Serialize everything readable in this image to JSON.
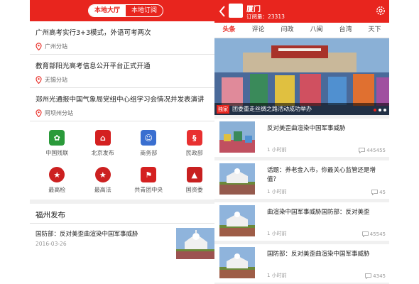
{
  "left": {
    "tabs": [
      "本地大厅",
      "本地订阅"
    ],
    "news": [
      {
        "title": "广州高考实行3+3模式，外语可考两次",
        "source": "广州分站"
      },
      {
        "title": "教育部阳光高考信息公开平台正式开通",
        "source": "无锡分站"
      },
      {
        "title": "郑州光通报中国气象局党组中心组学习会情况并发表演讲",
        "source": "阿坝州分站"
      }
    ],
    "grid": [
      {
        "label": "中国残联",
        "icon": "disabled-federation-icon",
        "color": "#2a9a3a"
      },
      {
        "label": "北京发布",
        "icon": "beijing-tiananmen-icon",
        "color": "#d42020"
      },
      {
        "label": "商务部",
        "icon": "commerce-ministry-icon",
        "color": "#3a6fd0"
      },
      {
        "label": "民政部",
        "icon": "civil-affairs-icon",
        "color": "#e83030"
      },
      {
        "label": "最高检",
        "icon": "procuratorate-emblem-icon",
        "color": "#cc2020"
      },
      {
        "label": "最高法",
        "icon": "court-emblem-icon",
        "color": "#cc2020"
      },
      {
        "label": "共青团中央",
        "icon": "youth-league-flag-icon",
        "color": "#d42020"
      },
      {
        "label": "国资委",
        "icon": "sasac-logo-icon",
        "color": "#c82020"
      }
    ],
    "section_title": "福州发布",
    "article": {
      "title": "国防部：反对美歪曲渲染中国军事威胁",
      "date": "2016-03-26"
    }
  },
  "right": {
    "city": "厦门",
    "subscribers": "订阅量：23313",
    "tabs": [
      "头条",
      "评论",
      "问政",
      "八闽",
      "台湾",
      "天下"
    ],
    "hero": {
      "tag": "独家",
      "caption": "团委重走丝绸之路活动成功举办"
    },
    "items": [
      {
        "title": "反对美歪曲渲染中国军事威胁",
        "time": "1 小时前",
        "comments": "445455"
      },
      {
        "title": "话题：养老金入市，你最关心监管还是增值？",
        "time": "1 小时前",
        "comments": "45"
      },
      {
        "title": "曲渲染中国军事威胁国防部：反对美歪",
        "time": "1 小时前",
        "comments": "45545"
      },
      {
        "title": "国防部：反对美歪曲渲染中国军事威胁",
        "time": "1 小时前",
        "comments": "4345"
      }
    ]
  },
  "colors": {
    "brand_red": "#e8251e"
  }
}
